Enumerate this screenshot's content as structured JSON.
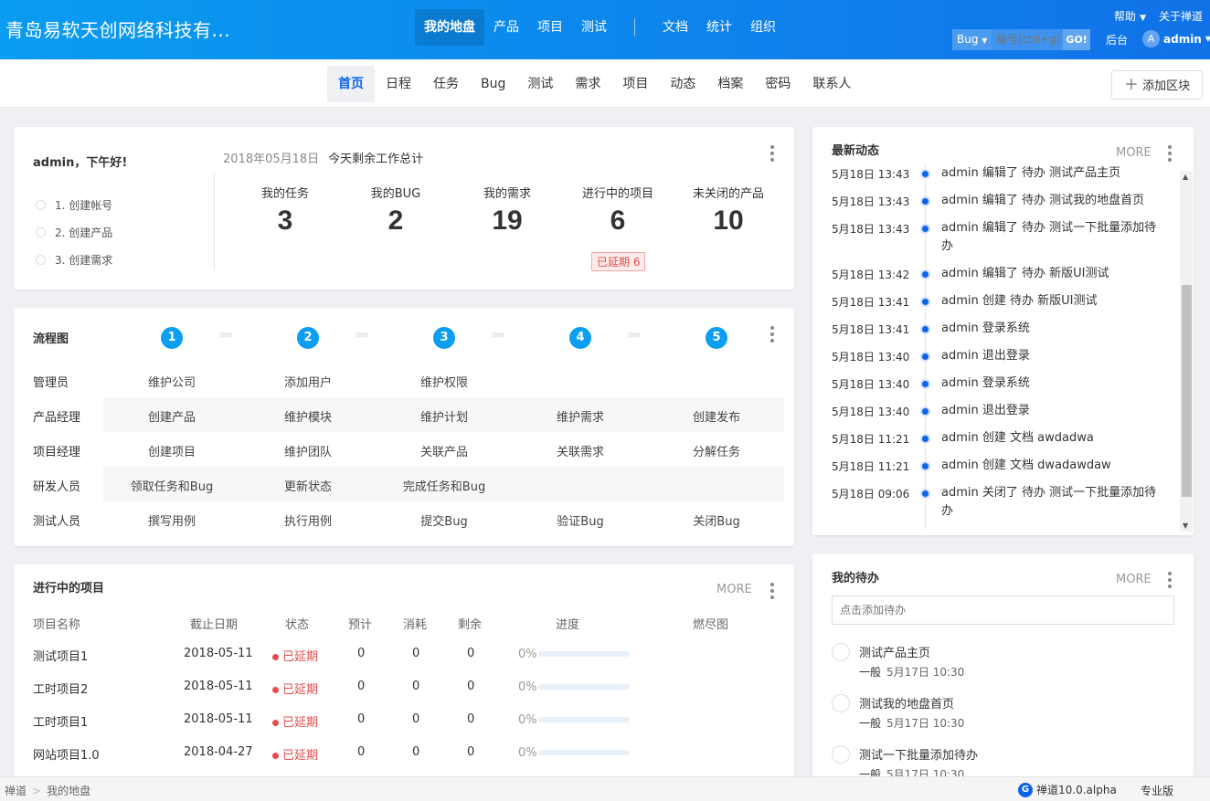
{
  "header": {
    "brand": "青岛易软天创网络科技有...",
    "nav": [
      "我的地盘",
      "产品",
      "项目",
      "测试"
    ],
    "nav2": [
      "文档",
      "统计",
      "组织"
    ],
    "help": "帮助",
    "about": "关于禅道",
    "search_type": "Bug",
    "search_placeholder": "编号(ctrl+g)",
    "go": "GO!",
    "backstage": "后台",
    "avatar_letter": "A",
    "user": "admin"
  },
  "subnav": {
    "items": [
      "首页",
      "日程",
      "任务",
      "Bug",
      "测试",
      "需求",
      "项目",
      "动态",
      "档案",
      "密码",
      "联系人"
    ],
    "add_block": "添加区块"
  },
  "welcome": {
    "greeting": "admin，下午好!",
    "steps": [
      "1. 创建帐号",
      "2. 创建产品",
      "3. 创建需求"
    ],
    "date": "2018年05月18日",
    "summary": "今天剩余工作总计",
    "stats": [
      {
        "label": "我的任务",
        "value": "3"
      },
      {
        "label": "我的BUG",
        "value": "2"
      },
      {
        "label": "我的需求",
        "value": "19"
      },
      {
        "label": "进行中的项目",
        "value": "6"
      },
      {
        "label": "未关闭的产品",
        "value": "10"
      }
    ],
    "delay_badge": "已延期 6"
  },
  "flow": {
    "title": "流程图",
    "steps": [
      "1",
      "2",
      "3",
      "4",
      "5"
    ],
    "chevrons": "›››››",
    "rows": [
      {
        "role": "管理员",
        "cells": [
          "维护公司",
          "添加用户",
          "维护权限",
          "",
          ""
        ]
      },
      {
        "role": "产品经理",
        "cells": [
          "创建产品",
          "维护模块",
          "维护计划",
          "维护需求",
          "创建发布"
        ]
      },
      {
        "role": "项目经理",
        "cells": [
          "创建项目",
          "维护团队",
          "关联产品",
          "关联需求",
          "分解任务"
        ]
      },
      {
        "role": "研发人员",
        "cells": [
          "领取任务和Bug",
          "更新状态",
          "完成任务和Bug",
          "",
          ""
        ]
      },
      {
        "role": "测试人员",
        "cells": [
          "撰写用例",
          "执行用例",
          "提交Bug",
          "验证Bug",
          "关闭Bug"
        ]
      }
    ]
  },
  "projects": {
    "title": "进行中的项目",
    "more": "MORE",
    "headers": [
      "项目名称",
      "截止日期",
      "状态",
      "预计",
      "消耗",
      "剩余",
      "进度",
      "燃尽图"
    ],
    "rows": [
      {
        "name": "测试项目1",
        "date": "2018-05-11",
        "status": "已延期",
        "est": "0",
        "used": "0",
        "left": "0",
        "progress": "0%",
        "progress_value": 0
      },
      {
        "name": "工时项目2",
        "date": "2018-05-11",
        "status": "已延期",
        "est": "0",
        "used": "0",
        "left": "0",
        "progress": "0%",
        "progress_value": 0
      },
      {
        "name": "工时项目1",
        "date": "2018-05-11",
        "status": "已延期",
        "est": "0",
        "used": "0",
        "left": "0",
        "progress": "0%",
        "progress_value": 0
      },
      {
        "name": "网站项目1.0",
        "date": "2018-04-27",
        "status": "已延期",
        "est": "0",
        "used": "0",
        "left": "0",
        "progress": "0%",
        "progress_value": 0
      }
    ]
  },
  "activity": {
    "title": "最新动态",
    "more": "MORE",
    "items": [
      {
        "time": "5月18日 13:43",
        "text": "admin 编辑了 待办 测试产品主页"
      },
      {
        "time": "5月18日 13:43",
        "text": "admin 编辑了 待办 测试我的地盘首页"
      },
      {
        "time": "5月18日 13:43",
        "text": "admin 编辑了 待办 测试一下批量添加待办"
      },
      {
        "time": "5月18日 13:42",
        "text": "admin 编辑了 待办 新版UI测试"
      },
      {
        "time": "5月18日 13:41",
        "text": "admin 创建 待办 新版UI测试"
      },
      {
        "time": "5月18日 13:41",
        "text": "admin 登录系统"
      },
      {
        "time": "5月18日 13:40",
        "text": "admin 退出登录"
      },
      {
        "time": "5月18日 13:40",
        "text": "admin 登录系统"
      },
      {
        "time": "5月18日 13:40",
        "text": "admin 退出登录"
      },
      {
        "time": "5月18日 11:21",
        "text": "admin 创建 文档 awdadwa"
      },
      {
        "time": "5月18日 11:21",
        "text": "admin 创建 文档 dwadawdaw"
      },
      {
        "time": "5月18日 09:06",
        "text": "admin 关闭了 待办 测试一下批量添加待办"
      }
    ]
  },
  "todo": {
    "title": "我的待办",
    "more": "MORE",
    "placeholder": "点击添加待办",
    "items": [
      {
        "name": "测试产品主页",
        "pri": "一般",
        "time": "5月17日 10:30"
      },
      {
        "name": "测试我的地盘首页",
        "pri": "一般",
        "time": "5月17日 10:30"
      },
      {
        "name": "测试一下批量添加待办",
        "pri": "一般",
        "time": "5月17日 10:30"
      }
    ]
  },
  "footer": {
    "crumb_root": "禅道",
    "crumb_current": "我的地盘",
    "version": "禅道10.0.alpha",
    "edition": "专业版"
  }
}
